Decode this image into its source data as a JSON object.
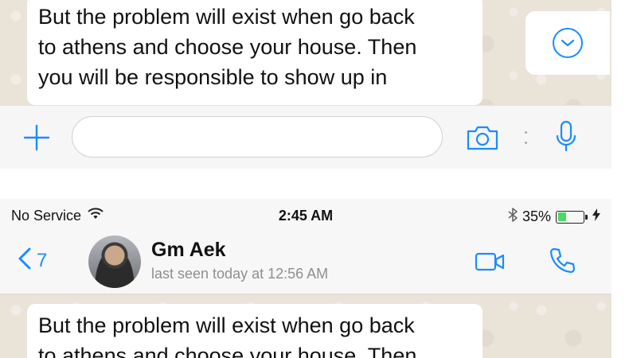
{
  "top_panel": {
    "message_lines": [
      "But the problem will exist when go back",
      "to athens and choose your house. Then",
      "you will be responsible to show up in",
      "                                              "
    ],
    "scroll_down_icon": "chevron-down-circle-icon",
    "input_bar": {
      "plus_icon": "plus-icon",
      "message_placeholder": "",
      "camera_icon": "camera-icon",
      "mic_icon": "microphone-icon"
    }
  },
  "status_bar": {
    "carrier": "No Service",
    "time": "2:45 AM",
    "battery_percent": "35%",
    "battery_level": 0.35
  },
  "chat_header": {
    "back_count": "7",
    "contact_name": "Gm Aek",
    "last_seen": "last seen today at 12:56 AM"
  },
  "bottom_panel": {
    "message_lines": [
      "But the problem will exist when go back",
      "to athens and choose your house. Then"
    ]
  },
  "colors": {
    "accent": "#1a8cff",
    "wallpaper": "#e9e3d8",
    "battery_green": "#4cd964"
  }
}
